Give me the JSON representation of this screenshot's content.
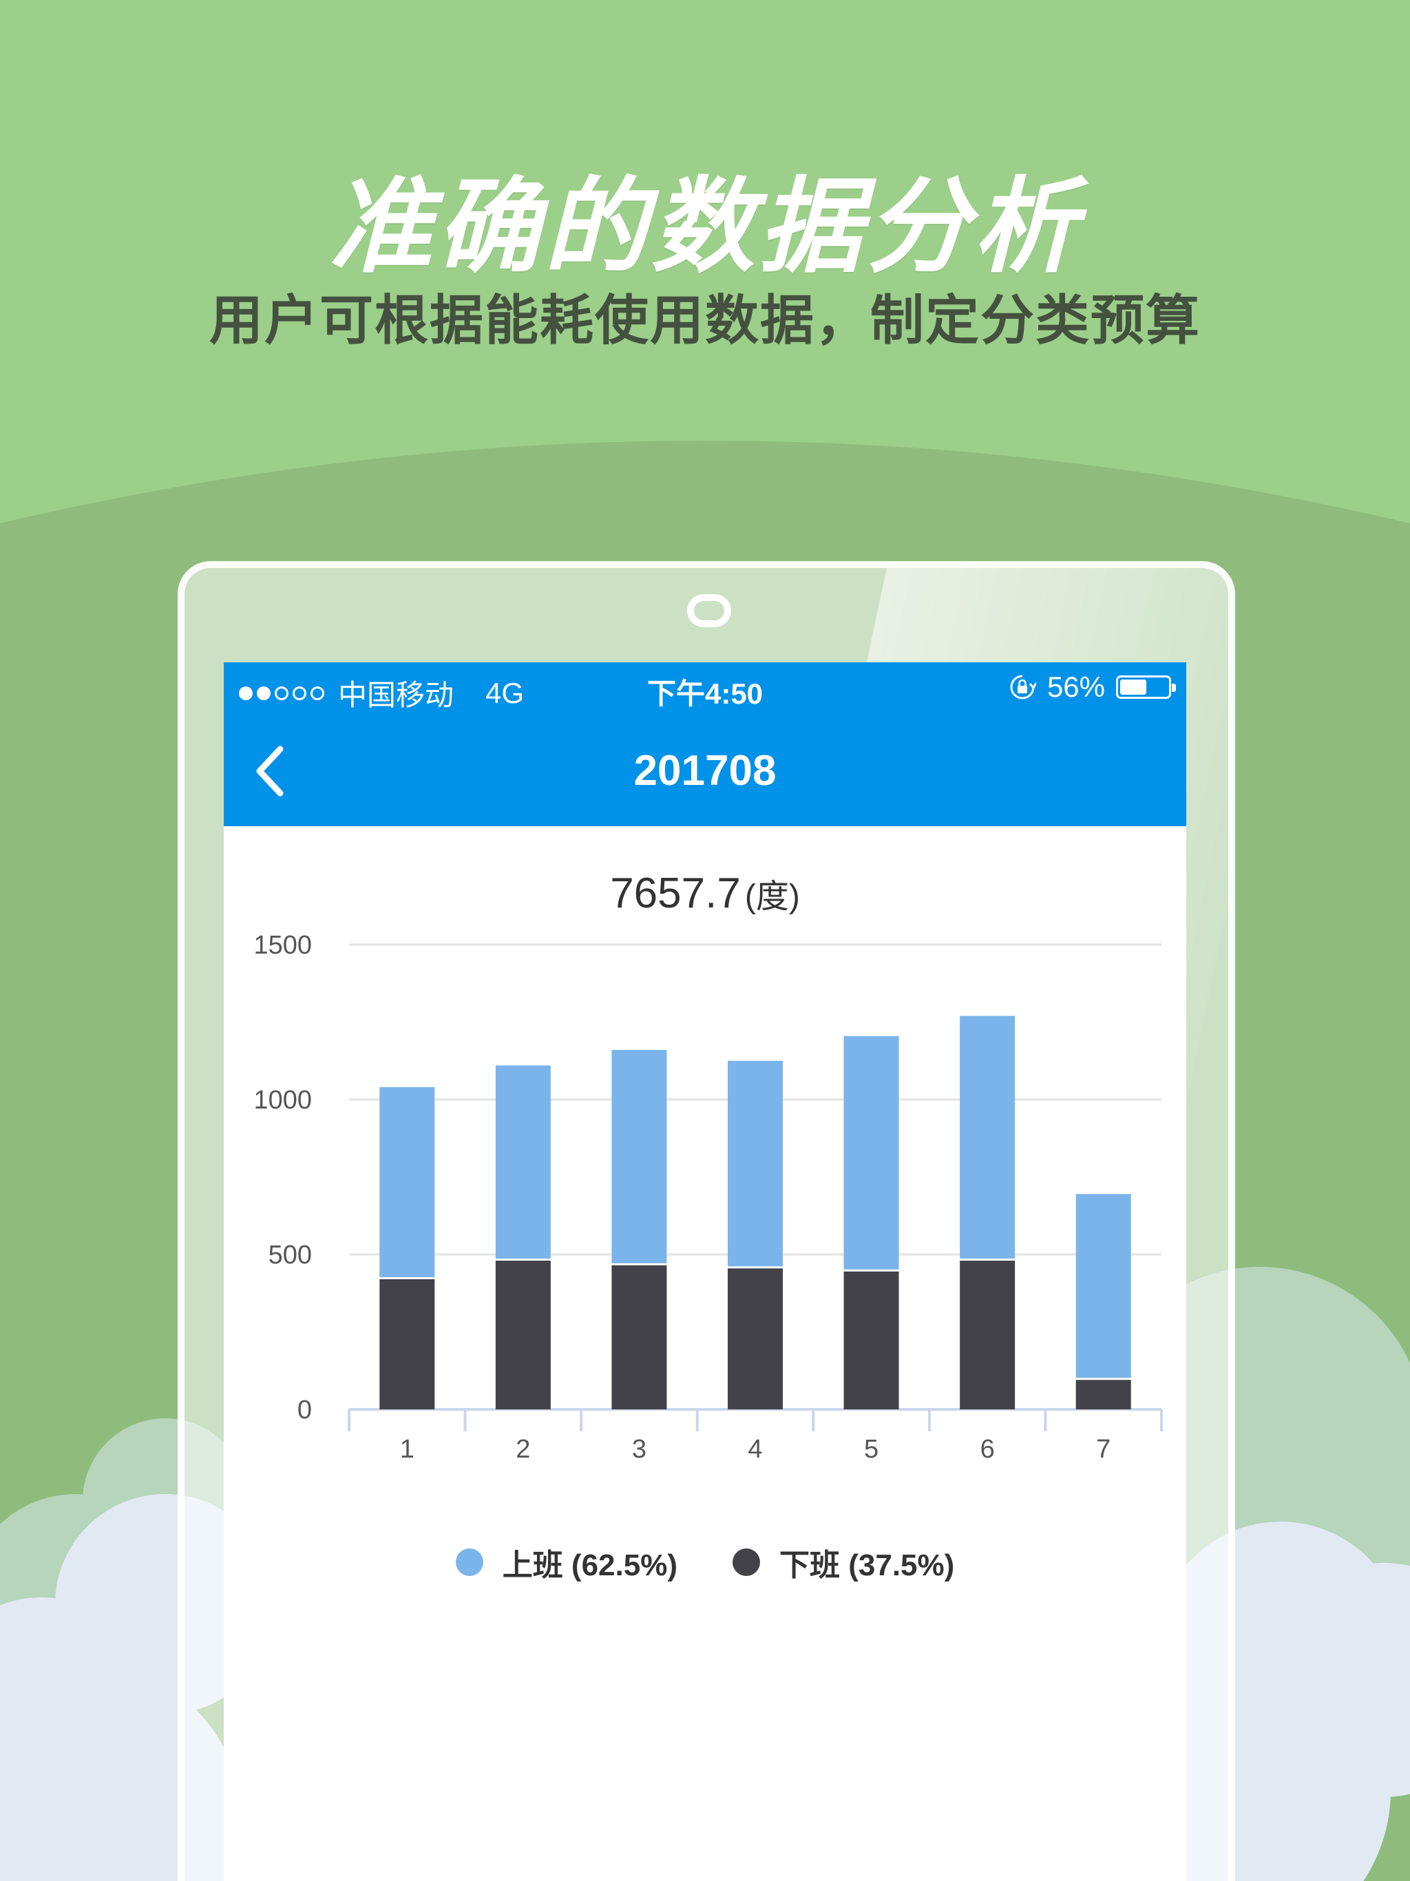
{
  "promo": {
    "headline": "准确的数据分析",
    "subheadline": "用户可根据能耗使用数据，制定分类预算"
  },
  "status_bar": {
    "signal_dots_filled": 2,
    "signal_dots_total": 5,
    "carrier": "中国移动",
    "network": "4G",
    "time": "下午4:50",
    "battery": "56%",
    "battery_level": 0.56,
    "lock_icon": "rotation-lock-icon"
  },
  "nav": {
    "back_icon": "chevron-left-icon",
    "title": "201708"
  },
  "summary": {
    "total_value": "7657.7",
    "unit": "(度)"
  },
  "colors": {
    "accent": "#0091e9",
    "on_duty": "#7ab4eb",
    "off_duty": "#434248",
    "background_green": "#9ccf8a"
  },
  "chart_data": {
    "type": "bar",
    "stacked": true,
    "categories": [
      "1",
      "2",
      "3",
      "4",
      "5",
      "6",
      "7"
    ],
    "series": [
      {
        "name": "下班 (37.5%)",
        "values": [
          420,
          480,
          465,
          455,
          445,
          480,
          95
        ]
      },
      {
        "name": "上班 (62.5%)",
        "values": [
          620,
          630,
          695,
          670,
          760,
          790,
          600
        ]
      }
    ],
    "ylim": [
      0,
      1500
    ],
    "yticks": [
      "0",
      "500",
      "1000",
      "1500"
    ],
    "grid": true,
    "legend": "bottom-center"
  },
  "legend": {
    "on_duty": "上班 (62.5%)",
    "off_duty": "下班 (37.5%)"
  }
}
